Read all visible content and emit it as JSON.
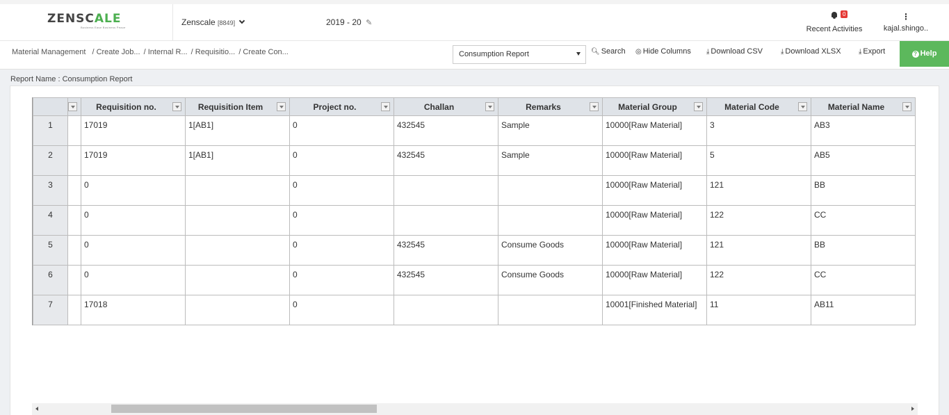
{
  "header": {
    "logo_main": "ZENSC",
    "logo_accent": "ALE",
    "logo_tagline": "Business Ease Business Peace",
    "company": "Zenscale",
    "company_code": "[8849]",
    "fiscal_year": "2019 - 20",
    "notification_count": "0",
    "recent_label": "Recent Activities",
    "user": "kajal.shingo.."
  },
  "breadcrumb": [
    "Material Management",
    "/ Create Job...",
    "/ Internal R...",
    "/ Requisitio...",
    "/ Create Con..."
  ],
  "toolbar": {
    "report_selected": "Consumption Report",
    "search": "Search",
    "hide_columns": "Hide Columns",
    "download_csv": "Download CSV",
    "download_xlsx": "Download XLSX",
    "export": "Export",
    "help": "Help"
  },
  "report_name": "Report Name : Consumption Report",
  "grid": {
    "columns": [
      "",
      "Requisition no.",
      "Requisition Item",
      "Project no.",
      "Challan",
      "Remarks",
      "Material Group",
      "Material Code",
      "Material Name"
    ],
    "rows": [
      [
        "1",
        "",
        "17019",
        "1[AB1]",
        "0",
        "432545",
        "Sample",
        "10000[Raw Material]",
        "3",
        "AB3"
      ],
      [
        "2",
        "",
        "17019",
        "1[AB1]",
        "0",
        "432545",
        "Sample",
        "10000[Raw Material]",
        "5",
        "AB5"
      ],
      [
        "3",
        "",
        "0",
        "",
        "0",
        "",
        "",
        "10000[Raw Material]",
        "121",
        "BB"
      ],
      [
        "4",
        "",
        "0",
        "",
        "0",
        "",
        "",
        "10000[Raw Material]",
        "122",
        "CC"
      ],
      [
        "5",
        "",
        "0",
        "",
        "0",
        "432545",
        "Consume Goods",
        "10000[Raw Material]",
        "121",
        "BB"
      ],
      [
        "6",
        "",
        "0",
        "",
        "0",
        "432545",
        "Consume Goods",
        "10000[Raw Material]",
        "122",
        "CC"
      ],
      [
        "7",
        "",
        "17018",
        "",
        "0",
        "",
        "",
        "10001[Finished Material]",
        "11",
        "AB11"
      ]
    ]
  }
}
